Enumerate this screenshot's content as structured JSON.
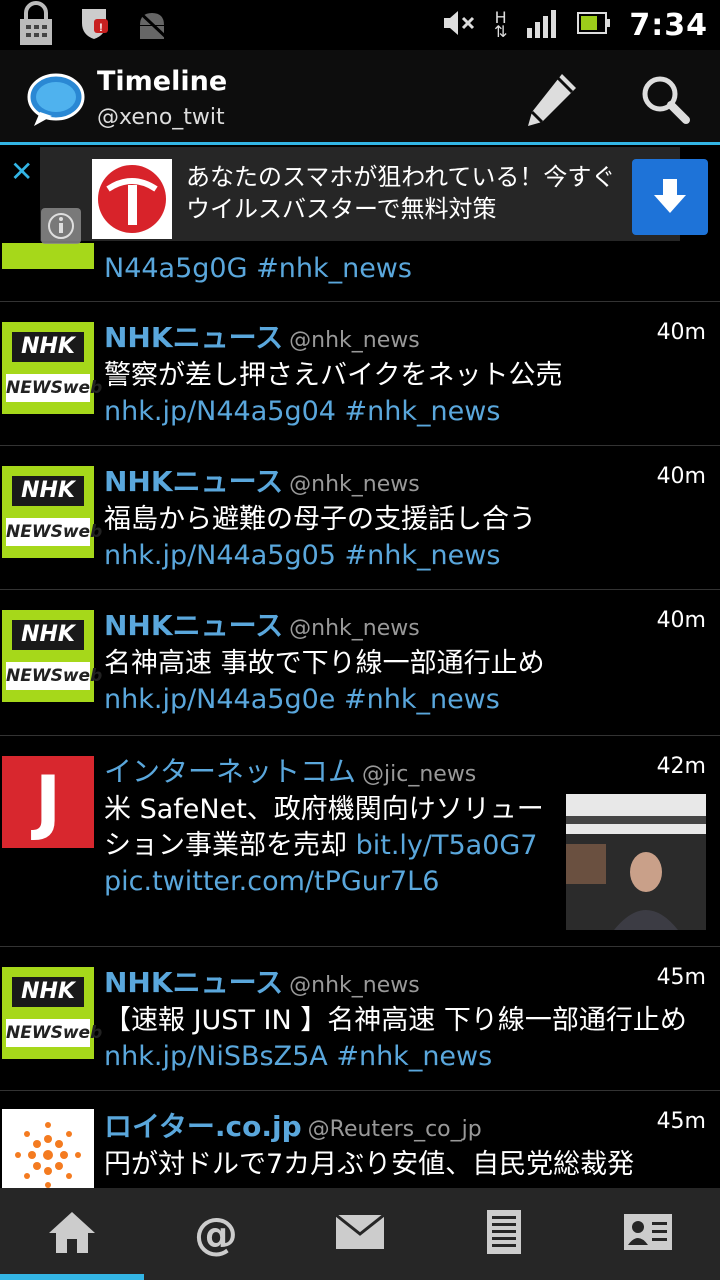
{
  "status_bar": {
    "time": "7:34",
    "network_type": "H",
    "icons": [
      "lock-icon",
      "shield-icon",
      "android-icon",
      "mute-icon",
      "data-arrows-icon",
      "signal-icon",
      "battery-icon"
    ]
  },
  "header": {
    "title": "Timeline",
    "account": "@xeno_twit",
    "icons": [
      "speech-bubble-logo-icon",
      "compose-pencil-icon",
      "search-icon"
    ],
    "accent_color": "#33b5e5"
  },
  "ad": {
    "close": "✕",
    "text": "あなたのスマホが狙われている！今すぐウイルスバスターで無料対策",
    "icons": [
      "virusbuster-logo-icon",
      "download-arrow-icon",
      "info-icon"
    ]
  },
  "timeline": {
    "partial_tweet": {
      "links": "N44a5g0G #nhk_news"
    },
    "tweets": [
      {
        "name": "NHKニュース",
        "handle": "@nhk_news",
        "time": "40m",
        "text": "警察が差し押さえバイクをネット公売 ",
        "link": "nhk.jp/N44a5g04 #nhk_news",
        "avatar": "nhk-logo"
      },
      {
        "name": "NHKニュース",
        "handle": "@nhk_news",
        "time": "40m",
        "text": "福島から避難の母子の支援話し合う ",
        "link": "nhk.jp/N44a5g05 #nhk_news",
        "avatar": "nhk-logo"
      },
      {
        "name": "NHKニュース",
        "handle": "@nhk_news",
        "time": "40m",
        "text": "名神高速 事故で下り線一部通行止め ",
        "link": "nhk.jp/N44a5g0e #nhk_news",
        "avatar": "nhk-logo"
      },
      {
        "name": "インターネットコム",
        "handle": "@jic_news",
        "time": "42m",
        "text": "米 SafeNet、政府機関向けソリューション事業部を売却 ",
        "link": "bit.ly/T5a0G7 pic.twitter.com/tPGur7L6",
        "avatar": "jic-logo",
        "has_thumbnail": true
      },
      {
        "name": "NHKニュース",
        "handle": "@nhk_news",
        "time": "45m",
        "text": "【速報 JUST IN 】名神高速 下り線一部通行止め ",
        "link": "nhk.jp/NiSBsZ5A #nhk_news",
        "avatar": "nhk-logo"
      },
      {
        "name": "ロイター.co.jp",
        "handle": "@Reuters_co_jp",
        "time": "45m",
        "text": "円が対ドルで7カ月ぶり安値、自民党総裁発",
        "link": "",
        "avatar": "reuters-logo"
      }
    ],
    "nhk_logo_top": "NHK",
    "nhk_logo_bottom": "NEWSweb",
    "jic_logo": "J"
  },
  "bottom_nav": {
    "items": [
      "home-icon",
      "mentions-at-icon",
      "messages-envelope-icon",
      "lists-icon",
      "profile-card-icon"
    ],
    "at_glyph": "@",
    "active_index": 0
  }
}
